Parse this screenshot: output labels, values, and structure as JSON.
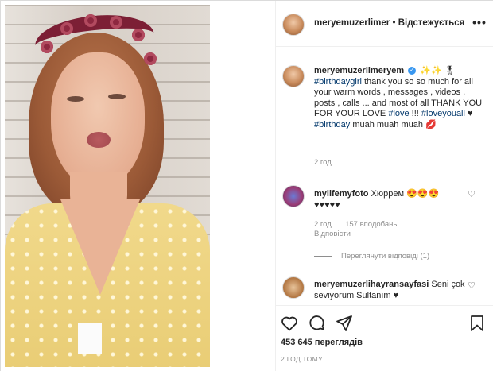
{
  "header": {
    "username": "meryemuzerlimer",
    "separator": "•",
    "follow_status": "Відстежується",
    "more_icon": "more-dots-icon"
  },
  "caption": {
    "username": "meryemuzerlimeryem",
    "emoji": "✨✨ 🎖",
    "hashtag1": "#birthdaygirl",
    "text1": " thank you so so much for all your warm words , messages , videos , posts , calls ... and most of all THANK YOU FOR YOUR LOVE ",
    "hashtag2": "#love",
    "text2": " !!! ",
    "hashtag3": "#loveyouall",
    "text3": " ♥ ",
    "hashtag4": "#birthday",
    "text4": " muah muah muah 💋",
    "time": "2 год."
  },
  "comment1": {
    "username": "mylifemyfoto",
    "text": " Хюррем 😍😍😍 ♥♥♥♥♥",
    "time": "2 год.",
    "likes": "157 вподобань",
    "reply": "Відповісти"
  },
  "view_replies": "Переглянути відповіді (1)",
  "comment2": {
    "username": "meryemuzerlihayransayfasi",
    "text": " Seni çok seviyorum Sultanım ♥"
  },
  "actions": {
    "views": "453 645 переглядів",
    "date": "2 ГОД ТОМУ"
  }
}
